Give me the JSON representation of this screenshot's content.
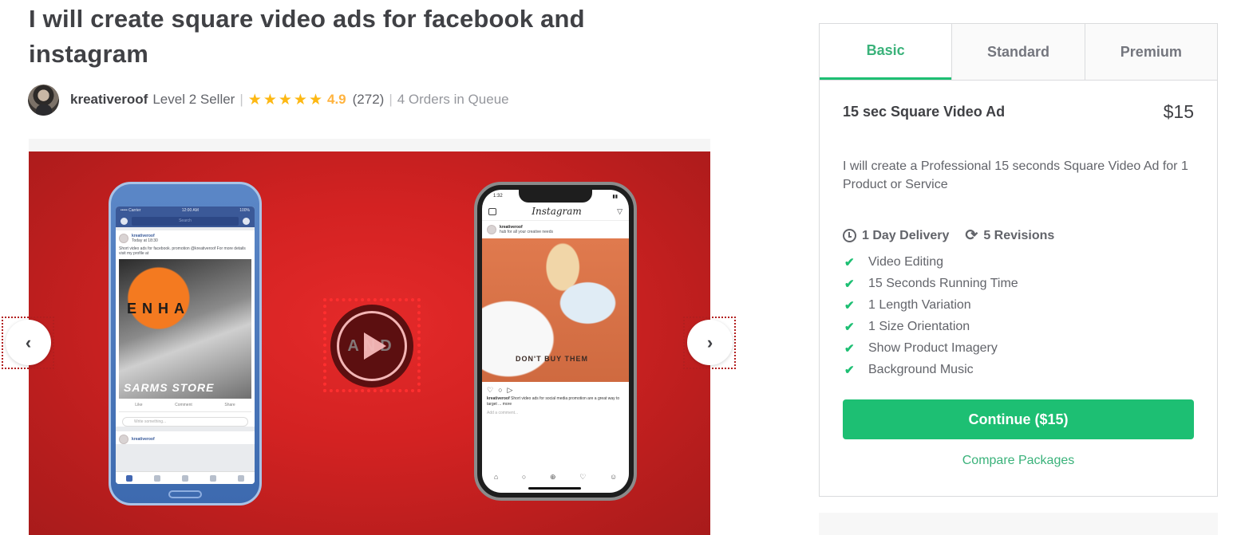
{
  "gig": {
    "title": "I will create square video ads for facebook and instagram"
  },
  "seller": {
    "name": "kreativeroof",
    "level": "Level 2 Seller",
    "separator": "|",
    "star_glyph": "★",
    "stars": 5,
    "rating": "4.9",
    "reviews": "(272)",
    "queue": "4 Orders in Queue"
  },
  "gallery": {
    "prev_icon": "‹",
    "next_icon": "›",
    "play_overlay_text": "AND",
    "facebook_mock": {
      "status_left": "••••• Carrier",
      "status_time": "12:00 AM",
      "status_right": "100%",
      "search_placeholder": "Search",
      "post_author": "kreativeroof",
      "post_time": "Today at 18:30",
      "post_text": "Short video ads for facebook. promotion @kreativeroof For more details visit my profile at",
      "image_text_1": "ENHA",
      "image_text_2": "SARMS STORE",
      "actions": [
        "Like",
        "Comment",
        "Share"
      ],
      "write_placeholder": "Write something..."
    },
    "instagram_mock": {
      "status_time": "1:32",
      "logo": "Instagram",
      "post_author": "kreativeroof",
      "post_sub": "hub for all your creative needs",
      "image_text": "DON'T BUY THEM",
      "caption_author": "kreativeroof",
      "caption": "Short video ads for social media promotion are a great way to target ... more",
      "comment_placeholder": "Add a comment..."
    }
  },
  "package": {
    "tabs": [
      {
        "label": "Basic",
        "active": true
      },
      {
        "label": "Standard",
        "active": false
      },
      {
        "label": "Premium",
        "active": false
      }
    ],
    "name": "15 sec Square Video Ad",
    "price": "$15",
    "description": "I will create a Professional 15 seconds Square Video Ad for 1 Product or Service",
    "delivery": "1 Day Delivery",
    "revisions": "5 Revisions",
    "check_glyph": "✔",
    "features": [
      "Video Editing",
      "15 Seconds Running Time",
      "1 Length Variation",
      "1 Size Orientation",
      "Show Product Imagery",
      "Background Music"
    ],
    "continue_label": "Continue ($15)",
    "compare_label": "Compare Packages"
  },
  "colors": {
    "accent_green": "#1dbf73",
    "tab_active_text": "#3ab27a",
    "star_yellow": "#fdb813",
    "rating_text": "#ffb33e",
    "slide_red": "#d32222"
  }
}
